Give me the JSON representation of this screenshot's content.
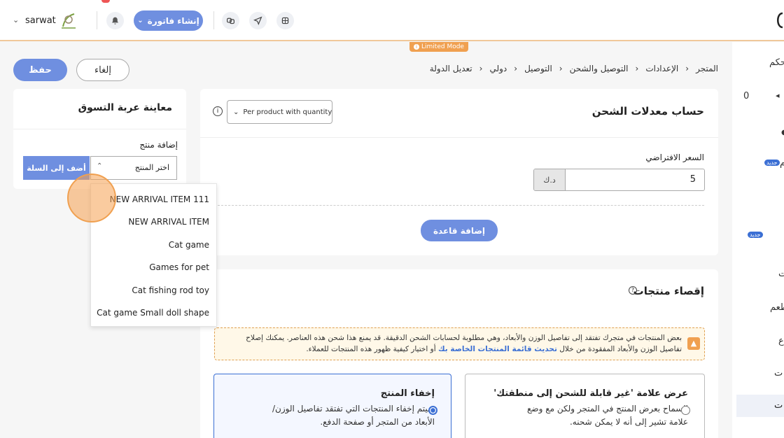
{
  "topbar": {
    "user_name": "sarwat",
    "create_invoice_label": "إنشاء فاتورة",
    "limited_mode_label": "Limited Mode"
  },
  "sidebar": {
    "items": [
      {
        "label": "حكم"
      },
      {
        "label": "0"
      },
      {
        "label": "جديد"
      },
      {
        "label": "جديد"
      },
      {
        "label": "ت"
      },
      {
        "label": "طعم"
      },
      {
        "label": "ت"
      },
      {
        "label": "ت"
      }
    ]
  },
  "header": {
    "save_label": "حفظ",
    "cancel_label": "إلغاء",
    "breadcrumb": [
      "المتجر",
      "الإعدادات",
      "التوصيل والشحن",
      "التوصيل",
      "دولي",
      "تعديل الدولة"
    ]
  },
  "shipping_card": {
    "title": "حساب معدلات الشحن",
    "calc_select_value": "Per product with quantity",
    "default_price_label": "السعر الافتراضي",
    "price_value": "5",
    "currency": "د.ك",
    "add_rule_label": "إضافة قاعدة"
  },
  "exclusion_card": {
    "title": "إقصاء منتجات",
    "warning_text": "بعض المنتجات في متجرك تفتقد إلى تفاصيل الوزن والأبعاد، وهي مطلوبة لحسابات الشحن الدقيقة. قد يمنع هذا شحن هذه العناصر. يمكنك إصلاح تفاصيل الوزن والأبعاد المفقودة من خلال",
    "warning_link": "تحديث قائمة المنتجات الخاصة بك",
    "warning_tail": "أو اختيار كيفية ظهور هذه المنتجات للعملاء.",
    "option_show_title": "عرض علامة 'غير قابلة للشحن إلى منطقتك'",
    "option_show_desc": "السماح بعرض المنتج في المتجر ولكن مع وضع علامة تشير إلى أنه لا يمكن شحنه.",
    "option_hide_title": "إخفاء المنتج",
    "option_hide_desc": "سيتم إخفاء المنتجات التي تفتقد تفاصيل الوزن/الأبعاد من المتجر أو صفحة الدفع."
  },
  "cart_preview": {
    "title": "معاينة عربة التسوق",
    "add_product_label": "إضافة منتج",
    "select_placeholder": "اختر المنتج",
    "add_to_cart_label": "أضف إلى السلة",
    "dropdown_options": [
      "NEW ARRIVAL ITEM 111",
      "NEW ARRIVAL ITEM",
      "Cat game",
      "Games for pet",
      "Cat fishing rod toy",
      "Cat game Small doll shape"
    ]
  },
  "colors": {
    "primary": "#6f8fe0",
    "accent_orange": "#f0a050",
    "warning_bg": "#fff8e8"
  }
}
